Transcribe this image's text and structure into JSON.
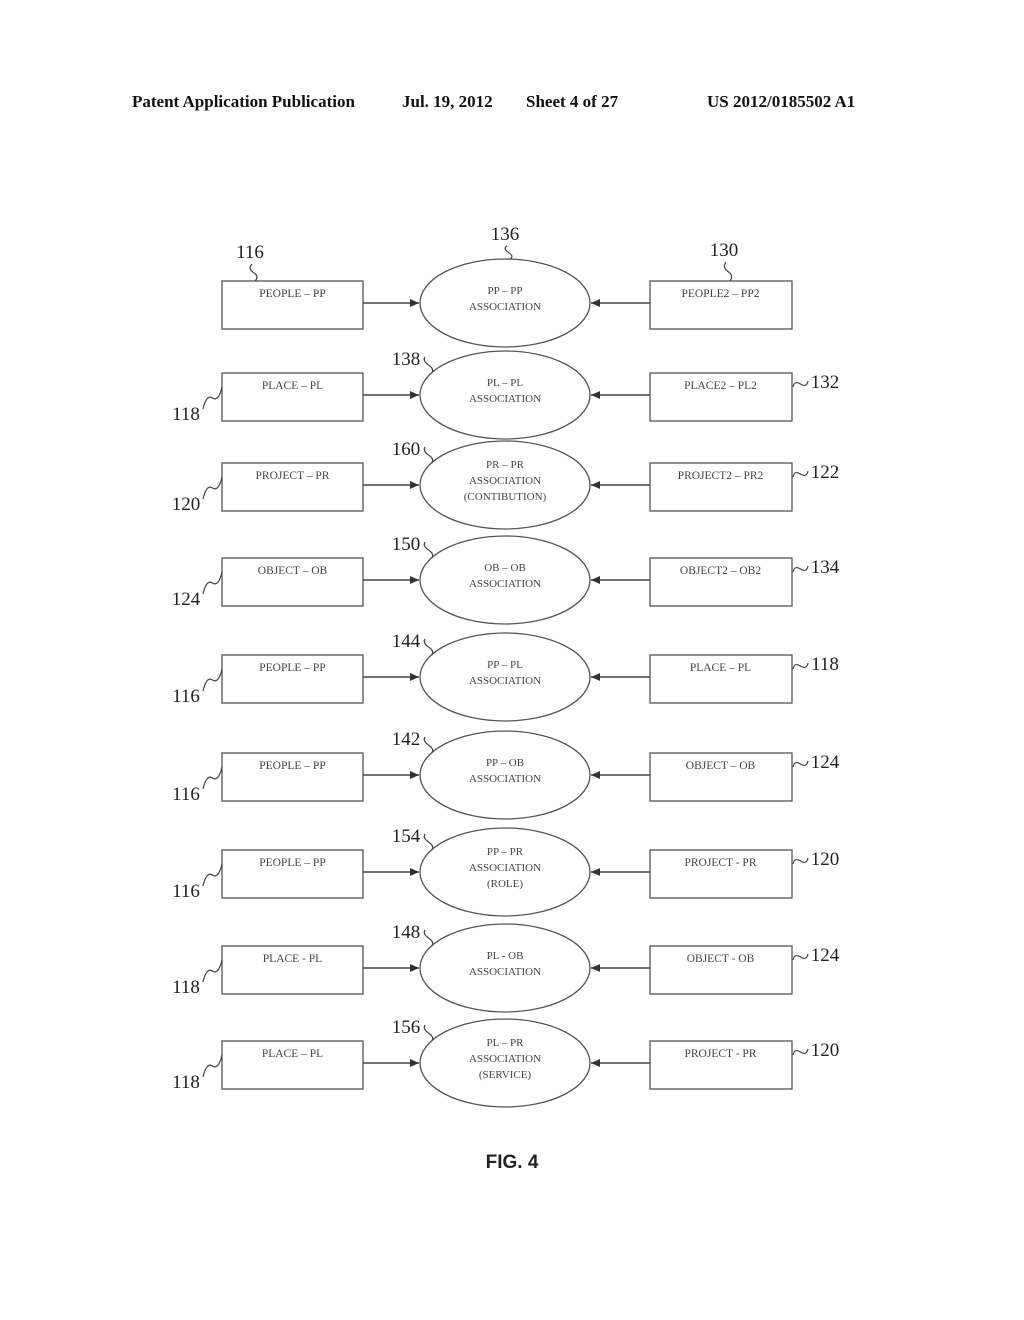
{
  "header": {
    "publication": "Patent Application Publication",
    "date": "Jul. 19, 2012",
    "sheet": "Sheet 4 of 27",
    "number": "US 2012/0185502 A1"
  },
  "figure_label": "FIG. 4",
  "rows": [
    {
      "left": {
        "label": "PEOPLE – PP",
        "ref": "116"
      },
      "assoc": {
        "lines": [
          "PP – PP",
          "ASSOCIATION"
        ],
        "ref": "136"
      },
      "right": {
        "label": "PEOPLE2 – PP2",
        "ref": "130"
      }
    },
    {
      "left": {
        "label": "PLACE – PL",
        "ref": "118"
      },
      "assoc": {
        "lines": [
          "PL – PL",
          "ASSOCIATION"
        ],
        "ref": "138"
      },
      "right": {
        "label": "PLACE2 – PL2",
        "ref": "132"
      }
    },
    {
      "left": {
        "label": "PROJECT – PR",
        "ref": "120"
      },
      "assoc": {
        "lines": [
          "PR – PR",
          "ASSOCIATION",
          "(CONTIBUTION)"
        ],
        "ref": "160"
      },
      "right": {
        "label": "PROJECT2 – PR2",
        "ref": "122"
      }
    },
    {
      "left": {
        "label": "OBJECT – OB",
        "ref": "124"
      },
      "assoc": {
        "lines": [
          "OB – OB",
          "ASSOCIATION"
        ],
        "ref": "150"
      },
      "right": {
        "label": "OBJECT2 – OB2",
        "ref": "134"
      }
    },
    {
      "left": {
        "label": "PEOPLE – PP",
        "ref": "116"
      },
      "assoc": {
        "lines": [
          "PP – PL",
          "ASSOCIATION"
        ],
        "ref": "144"
      },
      "right": {
        "label": "PLACE – PL",
        "ref": "118"
      }
    },
    {
      "left": {
        "label": "PEOPLE – PP",
        "ref": "116"
      },
      "assoc": {
        "lines": [
          "PP – OB",
          "ASSOCIATION"
        ],
        "ref": "142"
      },
      "right": {
        "label": "OBJECT – OB",
        "ref": "124"
      }
    },
    {
      "left": {
        "label": "PEOPLE – PP",
        "ref": "116"
      },
      "assoc": {
        "lines": [
          "PP – PR",
          "ASSOCIATION",
          "(ROLE)"
        ],
        "ref": "154"
      },
      "right": {
        "label": "PROJECT - PR",
        "ref": "120"
      }
    },
    {
      "left": {
        "label": "PLACE - PL",
        "ref": "118"
      },
      "assoc": {
        "lines": [
          "PL - OB",
          "ASSOCIATION"
        ],
        "ref": "148"
      },
      "right": {
        "label": "OBJECT - OB",
        "ref": "124"
      }
    },
    {
      "left": {
        "label": "PLACE – PL",
        "ref": "118"
      },
      "assoc": {
        "lines": [
          "PL – PR",
          "ASSOCIATION",
          "(SERVICE)"
        ],
        "ref": "156"
      },
      "right": {
        "label": "PROJECT - PR",
        "ref": "120"
      }
    }
  ]
}
